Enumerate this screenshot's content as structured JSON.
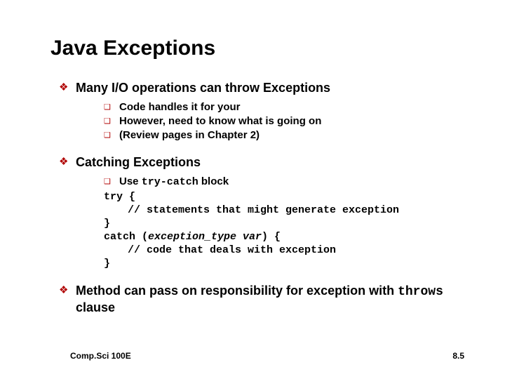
{
  "title": "Java Exceptions",
  "bullets": {
    "b1": {
      "text": "Many I/O operations can throw Exceptions",
      "sub": [
        "Code handles it for your",
        "However, need to know what is going on",
        "(Review pages in Chapter 2)"
      ]
    },
    "b2": {
      "text": "Catching Exceptions",
      "sub_prefix": "Use ",
      "sub_code": "try-catch",
      "sub_suffix": " block",
      "code": {
        "l1": "try {",
        "l2": "// statements that might generate exception",
        "l3": "}",
        "l4": "catch (",
        "l4_i": "exception_type var",
        "l4_end": ") {",
        "l5": "// code that deals with exception",
        "l6": "}"
      }
    },
    "b3": {
      "pre": "Method can pass on responsibility for exception with ",
      "code": "throws",
      "post": " clause"
    }
  },
  "footer": {
    "left": "Comp.Sci 100E",
    "right": "8.5"
  },
  "glyphs": {
    "diamond": "❖",
    "square": "❑"
  }
}
